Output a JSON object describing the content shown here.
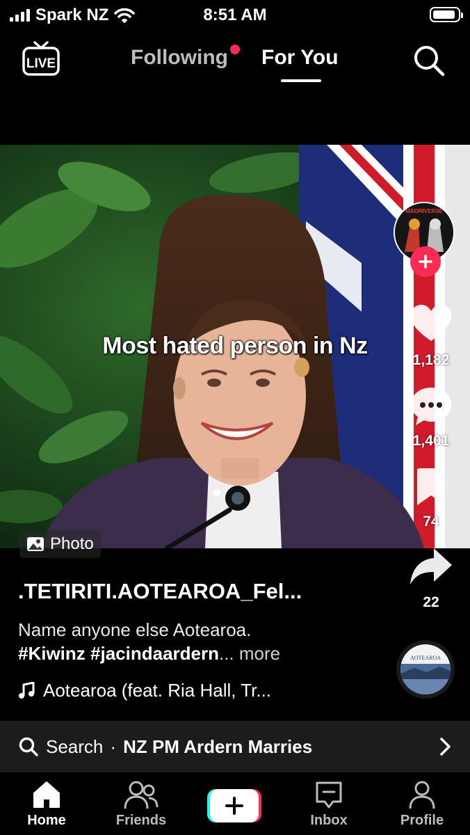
{
  "status_bar": {
    "carrier": "Spark NZ",
    "time": "8:51 AM",
    "battery_level": 0.9
  },
  "top_nav": {
    "live_label": "LIVE",
    "tabs": [
      {
        "label": "Following",
        "has_notification_dot": true
      },
      {
        "label": "For You",
        "selected": true
      }
    ],
    "search_icon": "search-icon"
  },
  "post": {
    "overlay_text": "Most hated person in Nz",
    "photo_badge": "Photo",
    "avatar_text": "MAORIVERSE",
    "likes": "1,182",
    "comments": "1,401",
    "bookmarks": "74",
    "shares": "22",
    "author": ".TETIRITI.AOTEAROA_Fel...",
    "description_line1": "Name anyone else Aotearoa.",
    "description_hashtags": "#Kiwinz #jacindaardern",
    "description_more": "... more",
    "music": "Aotearoa (feat. Ria Hall, Tr...",
    "music_disc_text": "AOTEAROA"
  },
  "search_bar": {
    "label": "Search",
    "separator": "·",
    "query": "NZ PM Ardern Marries"
  },
  "bottom_nav": {
    "items": [
      {
        "label": "Home",
        "icon": "home-icon",
        "selected": true
      },
      {
        "label": "Friends",
        "icon": "friends-icon"
      },
      {
        "label": "",
        "icon": "create-plus-icon"
      },
      {
        "label": "Inbox",
        "icon": "inbox-icon"
      },
      {
        "label": "Profile",
        "icon": "profile-icon"
      }
    ]
  },
  "colors": {
    "accent": "#fe2c55",
    "cyan": "#25f4ee",
    "background": "#000000"
  }
}
